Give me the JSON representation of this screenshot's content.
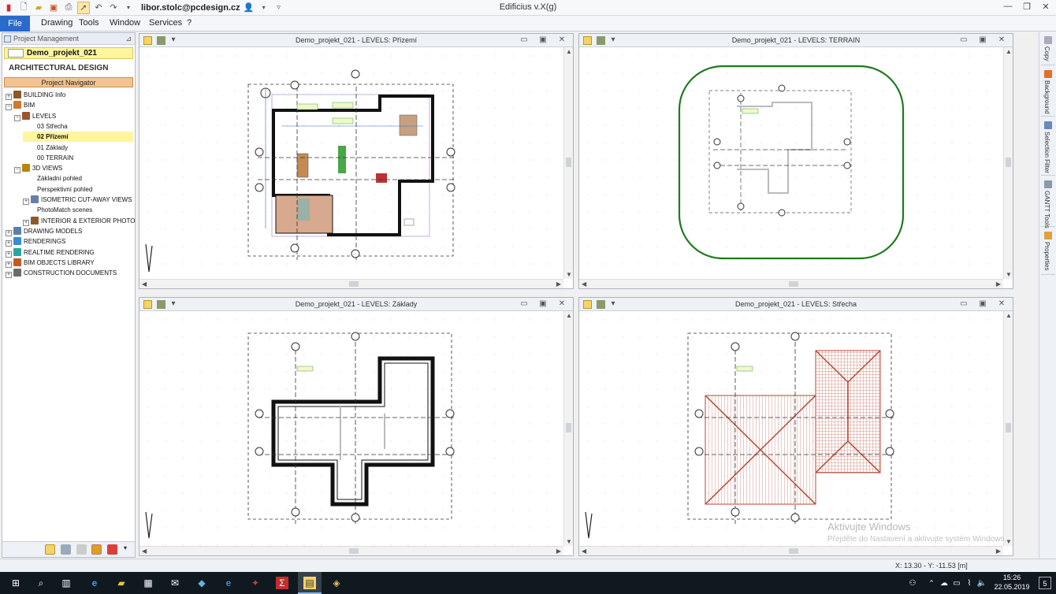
{
  "titlebar": {
    "user_email": "libor.stolc@pcdesign.cz",
    "app_title": "Edificius v.X(g)",
    "controls": [
      "—",
      "❐",
      "✕"
    ]
  },
  "menubar": {
    "items": [
      "File",
      "Drawing",
      "Tools",
      "Window",
      "Services",
      "?"
    ]
  },
  "left_panel": {
    "header": "Project Management",
    "project_name": "Demo_projekt_021",
    "section": "ARCHITECTURAL DESIGN",
    "navigator_button": "Project Navigator",
    "tree": [
      {
        "label": "BUILDING Info",
        "level": 0,
        "expander": "+",
        "icon_color": "#8b5a2b"
      },
      {
        "label": "BIM",
        "level": 0,
        "expander": "−",
        "icon_color": "#d07a30"
      },
      {
        "label": "LEVELS",
        "level": 1,
        "expander": "−",
        "icon_color": "#a0522d"
      },
      {
        "label": "03 Střecha",
        "level": 2,
        "expander": "",
        "icon_color": ""
      },
      {
        "label": "02 Přízemí",
        "level": 2,
        "expander": "",
        "icon_color": "",
        "selected": true
      },
      {
        "label": "01 Základy",
        "level": 2,
        "expander": "",
        "icon_color": ""
      },
      {
        "label": "00 TERRAIN",
        "level": 2,
        "expander": "",
        "icon_color": ""
      },
      {
        "label": "3D VIEWS",
        "level": 1,
        "expander": "−",
        "icon_color": "#b8860b"
      },
      {
        "label": "Základní pohled",
        "level": 2,
        "expander": "",
        "icon_color": ""
      },
      {
        "label": "Perspektivní pohled",
        "level": 2,
        "expander": "",
        "icon_color": ""
      },
      {
        "label": "ISOMETRIC CUT-AWAY VIEWS",
        "level": 2,
        "expander": "+",
        "icon_color": "#6a7fa8"
      },
      {
        "label": "PhotoMatch scenes",
        "level": 2,
        "expander": "",
        "icon_color": ""
      },
      {
        "label": "INTERIOR & EXTERIOR PHOTO",
        "level": 2,
        "expander": "+",
        "icon_color": "#8b5a2b"
      },
      {
        "label": "DRAWING MODELS",
        "level": 0,
        "expander": "+",
        "icon_color": "#5b7fb0"
      },
      {
        "label": "RENDERINGS",
        "level": 0,
        "expander": "+",
        "icon_color": "#3a8ad6"
      },
      {
        "label": "REALTIME RENDERING",
        "level": 0,
        "expander": "+",
        "icon_color": "#2ba3a3"
      },
      {
        "label": "BIM OBJECTS LIBRARY",
        "level": 0,
        "expander": "+",
        "icon_color": "#c05a2a"
      },
      {
        "label": "CONSTRUCTION DOCUMENTS",
        "level": 0,
        "expander": "+",
        "icon_color": "#6b6b6b"
      }
    ]
  },
  "viewports": [
    {
      "title": "Demo_projekt_021 -  LEVELS: Přízemí"
    },
    {
      "title": "Demo_projekt_021 -  LEVELS: TERRAIN"
    },
    {
      "title": "Demo_projekt_021 -  LEVELS: Základy"
    },
    {
      "title": "Demo_projekt_021 -  LEVELS: Střecha"
    }
  ],
  "viewport_controls": [
    "▭",
    "▣",
    "✕"
  ],
  "right_dock": {
    "tabs": [
      "Copy",
      "Background",
      "Selection Filter",
      "GANTT Tools",
      "Properties"
    ]
  },
  "statusbar": {
    "coordinates": "X: 13.30 - Y: -11.53 [m]"
  },
  "watermark": {
    "title": "Aktivujte Windows",
    "subtitle": "Přejděte do Nastavení a aktivujte systém Windows."
  },
  "taskbar": {
    "time": "15:26",
    "date": "22.05.2019",
    "notification_count": "5"
  }
}
